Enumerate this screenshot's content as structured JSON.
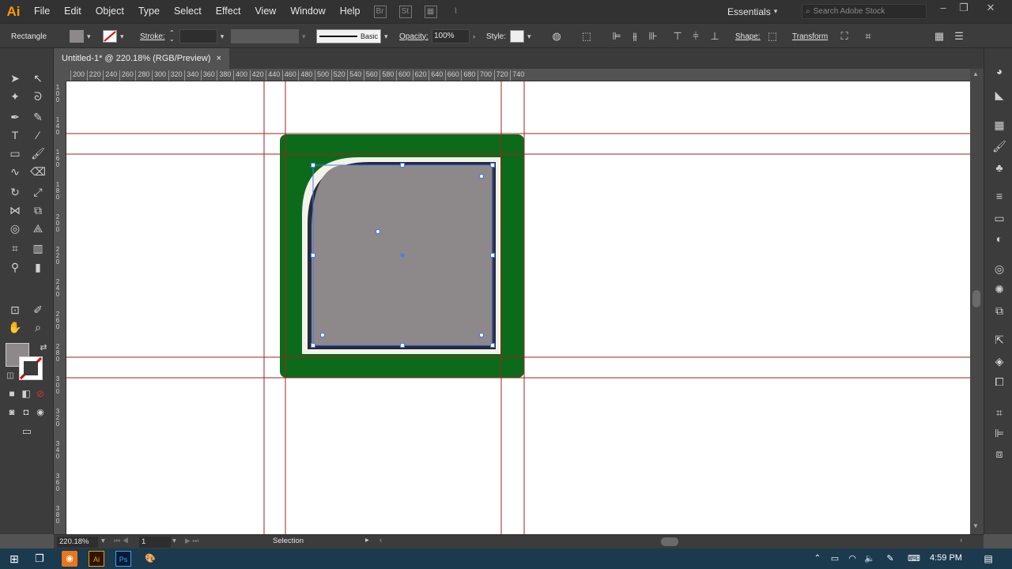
{
  "app": {
    "logo": "Ai",
    "accent": "#ff9a00"
  },
  "menu": [
    "File",
    "Edit",
    "Object",
    "Type",
    "Select",
    "Effect",
    "View",
    "Window",
    "Help"
  ],
  "workspace": {
    "label": "Essentials"
  },
  "stock_search": {
    "placeholder": "Search Adobe Stock"
  },
  "control_bar": {
    "selection_type": "Rectangle",
    "stroke_label": "Stroke:",
    "brush_label": "Basic",
    "opacity_label": "Opacity:",
    "opacity_value": "100%",
    "style_label": "Style:",
    "shape_label": "Shape:",
    "transform_label": "Transform"
  },
  "document_tab": {
    "title": "Untitled-1* @ 220.18% (RGB/Preview)",
    "close": "×"
  },
  "ruler": {
    "h_ticks": [
      "200",
      "220",
      "240",
      "260",
      "280",
      "300",
      "320",
      "340",
      "360",
      "380",
      "400",
      "420",
      "440",
      "460",
      "480",
      "500",
      "520",
      "540",
      "560",
      "580",
      "600",
      "620",
      "640",
      "660",
      "680",
      "700",
      "720",
      "740"
    ],
    "v_ticks": [
      "1\n0\n0",
      "1\n4\n0",
      "1\n6\n0",
      "1\n8\n0",
      "2\n0\n0",
      "2\n2\n0",
      "2\n4\n0",
      "2\n6\n0",
      "2\n8\n0",
      "3\n0\n0",
      "3\n2\n0",
      "3\n4\n0",
      "3\n6\n0",
      "3\n8\n0"
    ]
  },
  "colors": {
    "green_bg": "#0c6b1a",
    "cream": "#f3f3ea",
    "dark_stroke": "#262a3c",
    "gray_fill": "#8d8889",
    "guide": "#a02020",
    "selection": "#4a78f0"
  },
  "status_bar": {
    "zoom": "220.18%",
    "artboard": "1",
    "tool": "Selection"
  },
  "taskbar": {
    "time": "4:59 PM"
  }
}
